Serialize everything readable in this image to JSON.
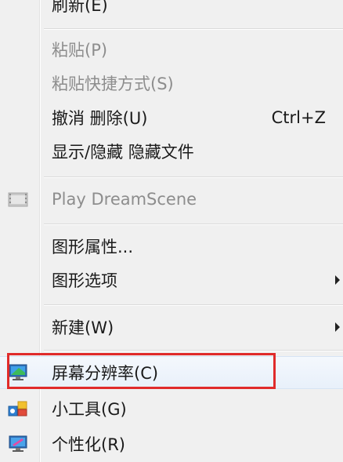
{
  "menu": {
    "refresh": {
      "label": "刷新(E)"
    },
    "paste": {
      "label": "粘贴(P)"
    },
    "paste_shortcut": {
      "label": "粘贴快捷方式(S)"
    },
    "undo": {
      "label": "撤消 删除(U)",
      "shortcut": "Ctrl+Z"
    },
    "show_hide": {
      "label": "显示/隐藏 隐藏文件"
    },
    "dreamscene": {
      "label": "Play DreamScene",
      "icon": "film-icon"
    },
    "graphics_props": {
      "label": "图形属性..."
    },
    "graphics_options": {
      "label": "图形选项"
    },
    "new": {
      "label": "新建(W)"
    },
    "screen_resolution": {
      "label": "屏幕分辨率(C)",
      "icon": "monitor-icon"
    },
    "gadgets": {
      "label": "小工具(G)",
      "icon": "gadgets-icon"
    },
    "personalize": {
      "label": "个性化(R)",
      "icon": "personalize-icon"
    }
  },
  "colors": {
    "highlight_box": "#e02b2b",
    "disabled_text": "#8d8d8d"
  }
}
